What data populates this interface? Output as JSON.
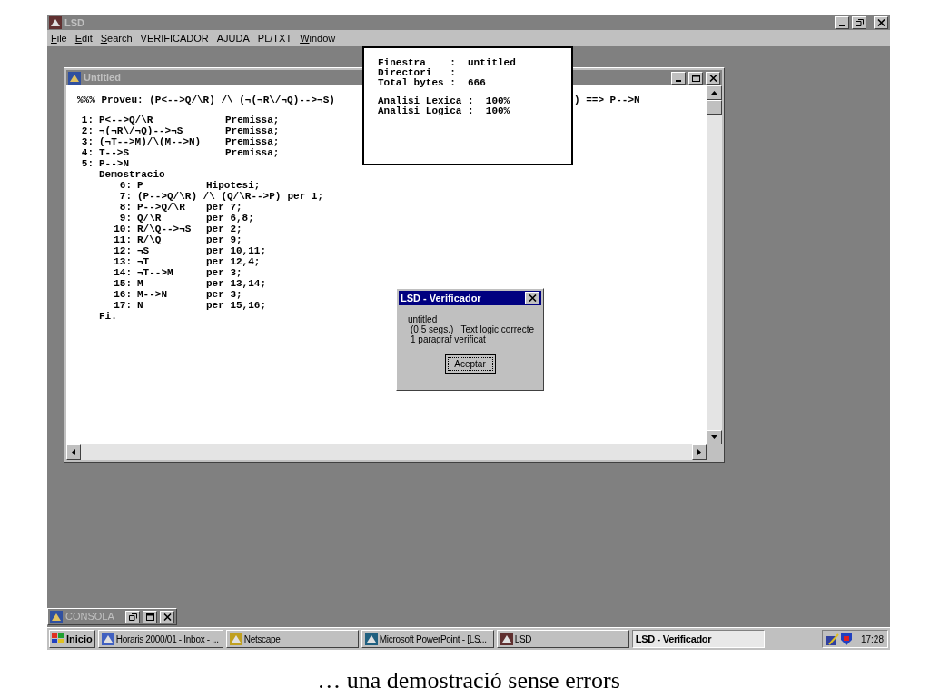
{
  "window": {
    "title": "LSD"
  },
  "menu": [
    {
      "mnemonic": "F",
      "rest": "ile"
    },
    {
      "mnemonic": "E",
      "rest": "dit"
    },
    {
      "mnemonic": "S",
      "rest": "earch"
    },
    {
      "label": "VERIFICADOR"
    },
    {
      "label": "AJUDA"
    },
    {
      "label": "PL/TXT"
    },
    {
      "mnemonic": "W",
      "rest": "indow"
    }
  ],
  "editor": {
    "title": "Untitled",
    "heading_left": "%%% Proveu: (P<-->Q/\\R) /\\ (¬(¬R\\/¬Q)-->¬S)",
    "heading_right": ") ==> P-->N",
    "premises": [
      {
        "number": "1:",
        "formula": "P<-->Q/\\R",
        "justification": "Premissa;"
      },
      {
        "number": "2:",
        "formula": "¬(¬R\\/¬Q)-->¬S",
        "justification": "Premissa;"
      },
      {
        "number": "3:",
        "formula": "(¬T-->M)/\\(M-->N)",
        "justification": "Premissa;"
      },
      {
        "number": "4:",
        "formula": "T-->S",
        "justification": "Premissa;"
      },
      {
        "number": "5:",
        "formula": "P-->N"
      }
    ],
    "proof": {
      "label": "Demostracio",
      "children": [
        {
          "number": "6:",
          "formula": "P",
          "justification": "Hipotesi;"
        },
        {
          "number": "7:",
          "formula": "(P-->Q/\\R) /\\ (Q/\\R-->P)",
          "justification": "per 1;"
        },
        {
          "number": "8:",
          "formula": "P-->Q/\\R",
          "justification": "per 7;"
        },
        {
          "number": "9:",
          "formula": "Q/\\R",
          "justification": "per 6,8;"
        },
        {
          "number": "10:",
          "formula": "R/\\Q-->¬S",
          "justification": "per 2;"
        },
        {
          "number": "11:",
          "formula": "R/\\Q",
          "justification": "per 9;"
        },
        {
          "number": "12:",
          "formula": "¬S",
          "justification": "per 10,11;"
        },
        {
          "number": "13:",
          "formula": "¬T",
          "justification": "per 12,4;"
        },
        {
          "number": "14:",
          "formula": "¬T-->M",
          "justification": "per 3;"
        },
        {
          "number": "15:",
          "formula": "M",
          "justification": "per 13,14;"
        },
        {
          "number": "16:",
          "formula": "M-->N",
          "justification": "per 3;"
        },
        {
          "number": "17:",
          "formula": "N",
          "justification": "per 15,16;"
        }
      ],
      "end": "Fi."
    }
  },
  "info_panel": {
    "groups": [
      [
        "Finestra    :  untitled",
        "Directori   :",
        "Total bytes :  666"
      ],
      [
        "Analisi Lexica :  100%",
        "Analisi Logica :  100%"
      ]
    ]
  },
  "dialog": {
    "title": "LSD - Verificador",
    "lines": [
      "untitled",
      "(0.5 segs.)   Text logic correcte",
      "1 paragraf verificat"
    ],
    "button": "Aceptar"
  },
  "minimized_window": {
    "title": "CONSOLA"
  },
  "taskbar": {
    "start": "Inicio",
    "tasks": [
      {
        "label": "Horaris 2000/01 - Inbox - ...",
        "selected": false
      },
      {
        "label": "Netscape",
        "selected": false
      },
      {
        "label": "Microsoft PowerPoint - [LS...",
        "selected": false
      },
      {
        "label": "LSD",
        "selected": false
      },
      {
        "label": "LSD - Verificador",
        "selected": true
      }
    ],
    "clock": "17:28"
  },
  "caption": "… una demostració sense errors"
}
